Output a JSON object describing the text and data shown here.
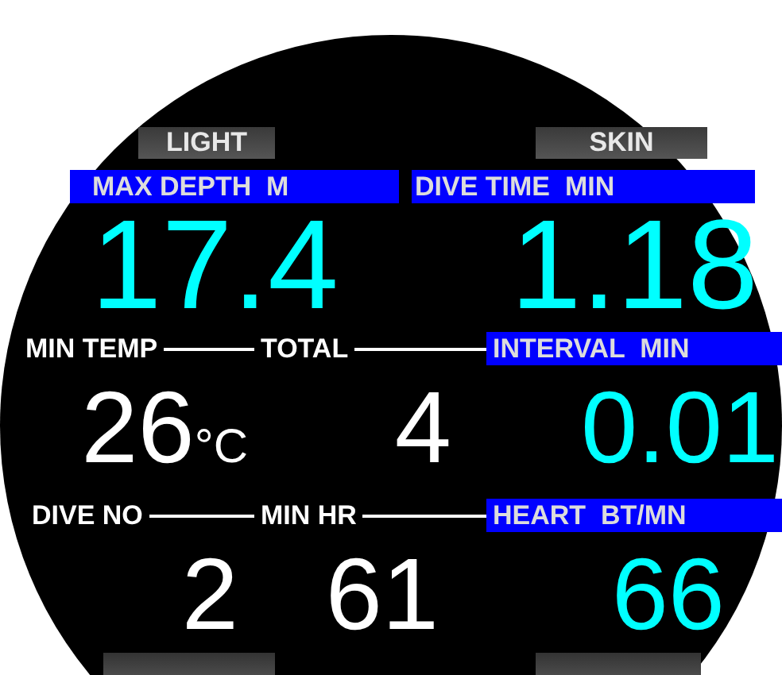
{
  "softkeys": [
    {
      "label": "LIGHT"
    },
    {
      "label": "SKIN"
    }
  ],
  "primary": [
    {
      "header": "MAX DEPTH  M",
      "value": "17.4"
    },
    {
      "header": "DIVE TIME  MIN",
      "value": "1.18"
    }
  ],
  "stats": [
    {
      "label": "MIN TEMP",
      "value": "26",
      "unit": "°C"
    },
    {
      "label": "TOTAL",
      "value": "4"
    },
    {
      "label": "DIVE NO",
      "value": "2"
    },
    {
      "label": "MIN HR",
      "value": "61"
    }
  ],
  "side": [
    {
      "header": "INTERVAL  MIN",
      "value": "0.01"
    },
    {
      "header": "HEART  BT/MN",
      "value": "66"
    }
  ]
}
